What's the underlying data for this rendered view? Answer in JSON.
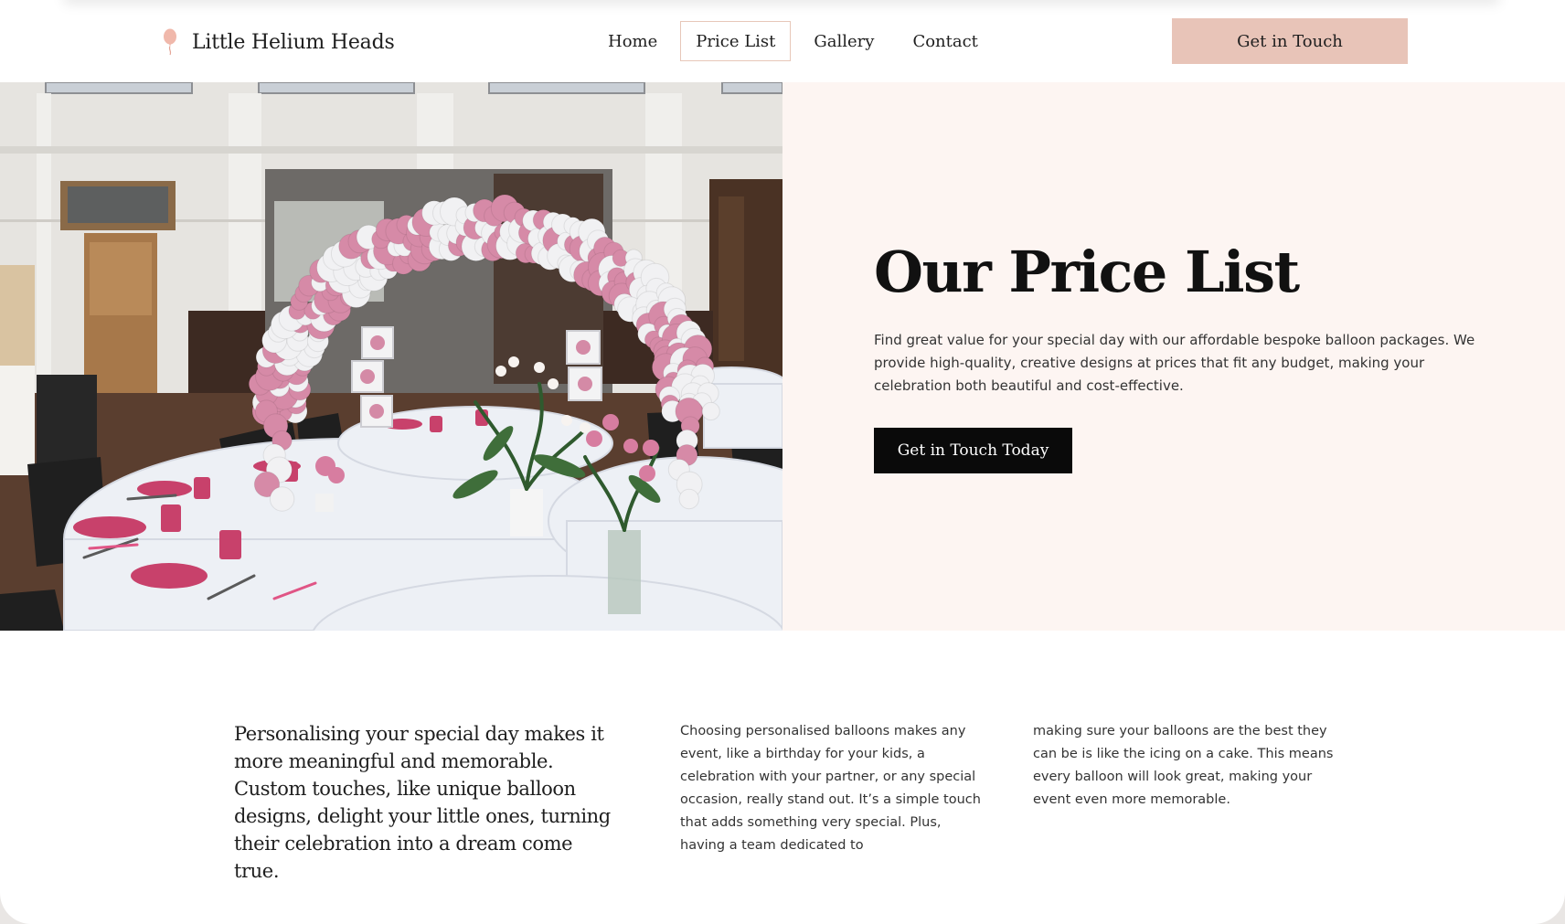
{
  "brand": {
    "name": "Little Helium Heads",
    "icon": "balloon-icon",
    "icon_color": "#f0b8ab"
  },
  "nav": {
    "items": [
      {
        "label": "Home",
        "active": false
      },
      {
        "label": "Price List",
        "active": true
      },
      {
        "label": "Gallery",
        "active": false
      },
      {
        "label": "Contact",
        "active": false
      }
    ]
  },
  "header": {
    "cta_label": "Get in Touch"
  },
  "hero": {
    "title": "Our Price List",
    "body": "Find great value for your special day with our affordable bespoke balloon packages. We provide high-quality, creative designs at prices that fit any budget, making your celebration both beautiful and cost-effective.",
    "cta_label": "Get in Touch Today",
    "image_subject": "balloon-arch-event-photo"
  },
  "intro": {
    "lead": "Personalising your special day makes it more meaningful and memorable. Custom touches, like unique balloon designs, delight your little ones, turning their celebration into a dream come true.",
    "column_1": "Choosing personalised balloons makes any event, like a birthday for your kids, a celebration with your partner, or any special occasion, really stand out. It’s a simple touch that adds something very special. Plus, having a team dedicated to",
    "column_2": "making sure your balloons are the best they can be is like the icing on a cake. This means every balloon will look great, making your event even more memorable."
  },
  "colors": {
    "accent": "#e8c4b8",
    "hero_panel": "#fdf5f2",
    "dark_button": "#0a0a0a",
    "balloon_pink": "#d68aa7",
    "balloon_white": "#f1f1f3"
  }
}
